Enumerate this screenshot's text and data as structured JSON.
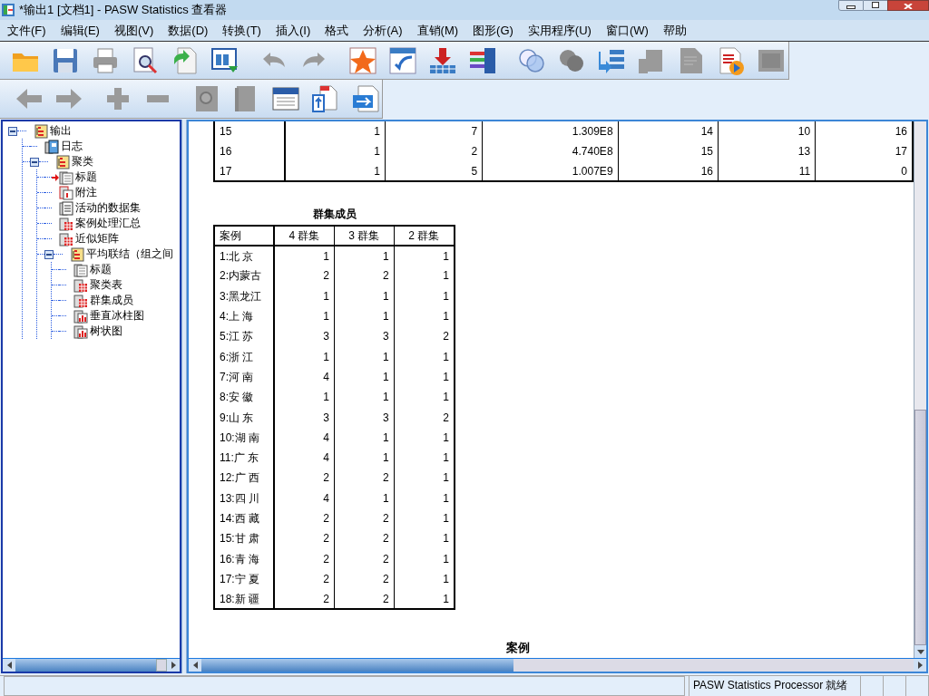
{
  "window": {
    "title": "*输出1 [文档1] - PASW Statistics 查看器"
  },
  "menu": [
    "文件(F)",
    "编辑(E)",
    "视图(V)",
    "数据(D)",
    "转换(T)",
    "插入(I)",
    "格式",
    "分析(A)",
    "直销(M)",
    "图形(G)",
    "实用程序(U)",
    "窗口(W)",
    "帮助"
  ],
  "outline": [
    {
      "label": "输出",
      "kind": "heading",
      "expanded": true,
      "selected": false,
      "children": [
        {
          "label": "日志",
          "kind": "log",
          "selected": false
        },
        {
          "label": "聚类",
          "kind": "heading",
          "expanded": true,
          "selected": false,
          "children": [
            {
              "label": "标题",
              "kind": "title",
              "selected": true
            },
            {
              "label": "附注",
              "kind": "note",
              "selected": false
            },
            {
              "label": "活动的数据集",
              "kind": "text",
              "selected": false
            },
            {
              "label": "案例处理汇总",
              "kind": "table",
              "selected": false
            },
            {
              "label": "近似矩阵",
              "kind": "table",
              "selected": false
            },
            {
              "label": "平均联结（组之间",
              "kind": "heading",
              "expanded": true,
              "selected": false,
              "children": [
                {
                  "label": "标题",
                  "kind": "title",
                  "selected": false
                },
                {
                  "label": "聚类表",
                  "kind": "table",
                  "selected": false
                },
                {
                  "label": "群集成员",
                  "kind": "table",
                  "selected": false
                },
                {
                  "label": "垂直冰柱图",
                  "kind": "chart",
                  "selected": false
                },
                {
                  "label": "树状图",
                  "kind": "chart",
                  "selected": false
                }
              ]
            }
          ]
        }
      ]
    }
  ],
  "schedule_table": {
    "rows": [
      [
        "15",
        "1",
        "7",
        "1.309E8",
        "14",
        "10",
        "16"
      ],
      [
        "16",
        "1",
        "2",
        "4.740E8",
        "15",
        "13",
        "17"
      ],
      [
        "17",
        "1",
        "5",
        "1.007E9",
        "16",
        "11",
        "0"
      ]
    ]
  },
  "membership_table": {
    "title": "群集成员",
    "columns": [
      "案例",
      "4 群集",
      "3 群集",
      "2 群集"
    ],
    "rows": [
      [
        "1:北 京",
        "1",
        "1",
        "1"
      ],
      [
        "2:内蒙古",
        "2",
        "2",
        "1"
      ],
      [
        "3:黑龙江",
        "1",
        "1",
        "1"
      ],
      [
        "4:上 海",
        "1",
        "1",
        "1"
      ],
      [
        "5:江 苏",
        "3",
        "3",
        "2"
      ],
      [
        "6:浙 江",
        "1",
        "1",
        "1"
      ],
      [
        "7:河 南",
        "4",
        "1",
        "1"
      ],
      [
        "8:安 徽",
        "1",
        "1",
        "1"
      ],
      [
        "9:山 东",
        "3",
        "3",
        "2"
      ],
      [
        "10:湖 南",
        "4",
        "1",
        "1"
      ],
      [
        "11:广 东",
        "4",
        "1",
        "1"
      ],
      [
        "12:广 西",
        "2",
        "2",
        "1"
      ],
      [
        "13:四 川",
        "4",
        "1",
        "1"
      ],
      [
        "14:西 藏",
        "2",
        "2",
        "1"
      ],
      [
        "15:甘 肃",
        "2",
        "2",
        "1"
      ],
      [
        "16:青 海",
        "2",
        "2",
        "1"
      ],
      [
        "17:宁 夏",
        "2",
        "2",
        "1"
      ],
      [
        "18:新 疆",
        "2",
        "2",
        "1"
      ]
    ]
  },
  "dendrogram": {
    "title": "案例"
  },
  "status_bar": {
    "message": "PASW Statistics Processor 就绪"
  }
}
